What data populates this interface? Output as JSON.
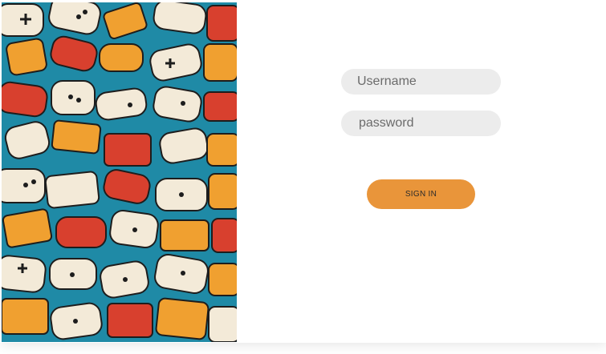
{
  "login": {
    "username_placeholder": "Username",
    "password_placeholder": "password",
    "signin_label": "SIGN IN"
  },
  "art": {
    "description_icon": "gamepad-collage-icon"
  },
  "colors": {
    "accent_bar": "#7c3aed",
    "button": "#e9953a",
    "field_bg": "#ececec",
    "art_bg": "#1f8aa6",
    "art_orange": "#f0a030",
    "art_red": "#d8402e",
    "art_cream": "#f3ead8"
  }
}
